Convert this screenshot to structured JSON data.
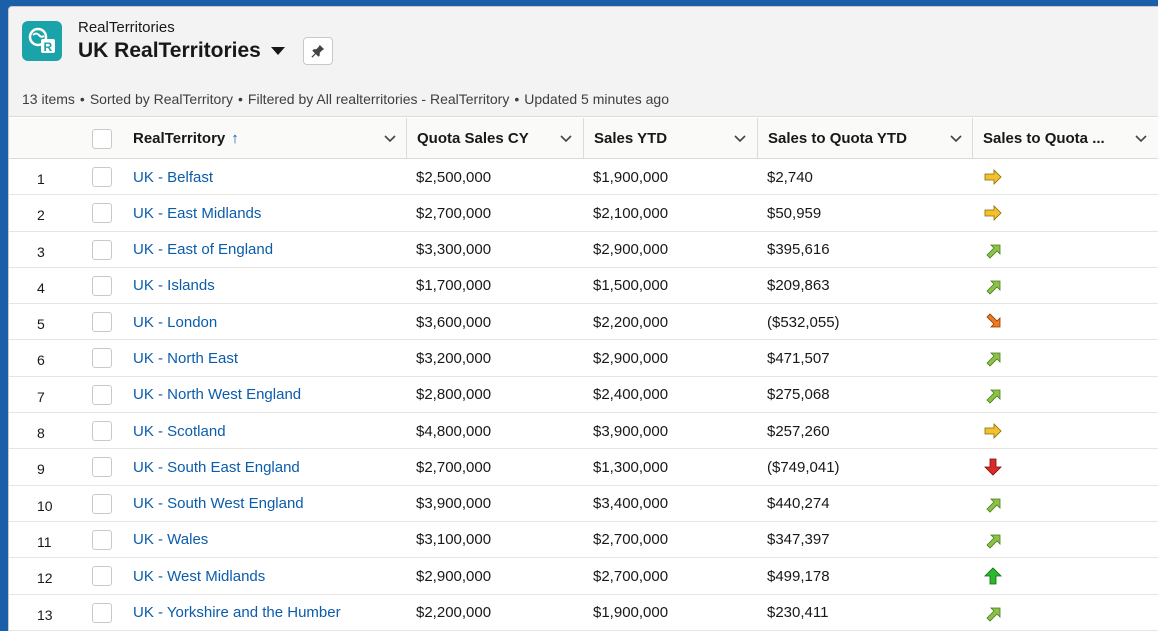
{
  "header": {
    "object_name": "RealTerritories",
    "list_title": "UK RealTerritories",
    "status": {
      "count": "13 items",
      "sort": "Sorted by RealTerritory",
      "filter": "Filtered by All realterritories - RealTerritory",
      "updated": "Updated 5 minutes ago"
    }
  },
  "columns": {
    "name": "RealTerritory",
    "quota": "Quota Sales CY",
    "ytd": "Sales YTD",
    "stq": "Sales to Quota YTD",
    "trend": "Sales to Quota ..."
  },
  "sort_indicator": "↑",
  "rows": [
    {
      "num": "1",
      "name": "UK - Belfast",
      "quota": "$2,500,000",
      "ytd": "$1,900,000",
      "stq": "$2,740",
      "trend": "right"
    },
    {
      "num": "2",
      "name": "UK - East Midlands",
      "quota": "$2,700,000",
      "ytd": "$2,100,000",
      "stq": "$50,959",
      "trend": "right"
    },
    {
      "num": "3",
      "name": "UK - East of England",
      "quota": "$3,300,000",
      "ytd": "$2,900,000",
      "stq": "$395,616",
      "trend": "up-right"
    },
    {
      "num": "4",
      "name": "UK - Islands",
      "quota": "$1,700,000",
      "ytd": "$1,500,000",
      "stq": "$209,863",
      "trend": "up-right"
    },
    {
      "num": "5",
      "name": "UK - London",
      "quota": "$3,600,000",
      "ytd": "$2,200,000",
      "stq": "($532,055)",
      "trend": "down-right"
    },
    {
      "num": "6",
      "name": "UK - North East",
      "quota": "$3,200,000",
      "ytd": "$2,900,000",
      "stq": "$471,507",
      "trend": "up-right"
    },
    {
      "num": "7",
      "name": "UK - North West England",
      "quota": "$2,800,000",
      "ytd": "$2,400,000",
      "stq": "$275,068",
      "trend": "up-right"
    },
    {
      "num": "8",
      "name": "UK - Scotland",
      "quota": "$4,800,000",
      "ytd": "$3,900,000",
      "stq": "$257,260",
      "trend": "right"
    },
    {
      "num": "9",
      "name": "UK - South East England",
      "quota": "$2,700,000",
      "ytd": "$1,300,000",
      "stq": "($749,041)",
      "trend": "down"
    },
    {
      "num": "10",
      "name": "UK - South West England",
      "quota": "$3,900,000",
      "ytd": "$3,400,000",
      "stq": "$440,274",
      "trend": "up-right"
    },
    {
      "num": "11",
      "name": "UK - Wales",
      "quota": "$3,100,000",
      "ytd": "$2,700,000",
      "stq": "$347,397",
      "trend": "up-right"
    },
    {
      "num": "12",
      "name": "UK - West Midlands",
      "quota": "$2,900,000",
      "ytd": "$2,700,000",
      "stq": "$499,178",
      "trend": "up"
    },
    {
      "num": "13",
      "name": "UK - Yorkshire and the Humber",
      "quota": "$2,200,000",
      "ytd": "$1,900,000",
      "stq": "$230,411",
      "trend": "up-right"
    }
  ],
  "colors": {
    "link": "#0b5cab",
    "app_icon": "#1aa3a8",
    "arrow_right": "#f2c12e",
    "arrow_up_right": "#8bc34a",
    "arrow_down_right": "#f07a1e",
    "arrow_down": "#d92b2b",
    "arrow_up": "#2eb82e"
  }
}
